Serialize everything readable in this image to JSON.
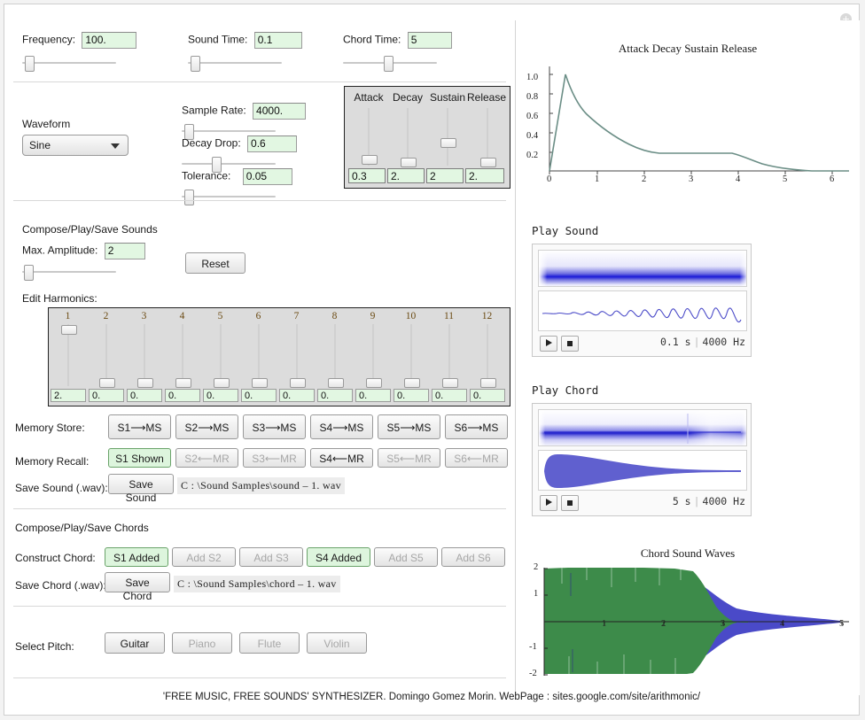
{
  "window": {
    "corner_icon": "gear-plus-icon"
  },
  "top_controls": [
    {
      "label": "Frequency:",
      "value": "100.",
      "slider_pct": 3
    },
    {
      "label": "Sound Time:",
      "value": "0.1",
      "slider_pct": 3
    },
    {
      "label": "Chord Time:",
      "value": "5",
      "slider_pct": 42
    }
  ],
  "waveform": {
    "label": "Waveform",
    "value": "Sine"
  },
  "mid_controls": [
    {
      "label": "Sample Rate:",
      "value": "4000.",
      "slider_pct": 3
    },
    {
      "label": "Decay Drop:",
      "value": "0.6",
      "slider_pct": 30
    },
    {
      "label": "Tolerance:",
      "value": "0.05",
      "slider_pct": 3
    }
  ],
  "adsr": {
    "columns": [
      {
        "name": "Attack",
        "value": "0.3",
        "thumb_pct": 82
      },
      {
        "name": "Decay",
        "value": "2.",
        "thumb_pct": 86
      },
      {
        "name": "Sustain",
        "value": "2",
        "thumb_pct": 52
      },
      {
        "name": "Release",
        "value": "2.",
        "thumb_pct": 86
      }
    ]
  },
  "sounds_section": {
    "title": "Compose/Play/Save Sounds",
    "max_amplitude_label": "Max. Amplitude:",
    "max_amplitude_value": "2",
    "max_amplitude_slider_pct": 3,
    "reset_label": "Reset",
    "edit_harmonics_label": "Edit Harmonics:",
    "harmonics": [
      {
        "n": "1",
        "value": "2.",
        "thumb_pct": 2
      },
      {
        "n": "2",
        "value": "0.",
        "thumb_pct": 92
      },
      {
        "n": "3",
        "value": "0.",
        "thumb_pct": 92
      },
      {
        "n": "4",
        "value": "0.",
        "thumb_pct": 92
      },
      {
        "n": "5",
        "value": "0.",
        "thumb_pct": 92
      },
      {
        "n": "6",
        "value": "0.",
        "thumb_pct": 92
      },
      {
        "n": "7",
        "value": "0.",
        "thumb_pct": 92
      },
      {
        "n": "8",
        "value": "0.",
        "thumb_pct": 92
      },
      {
        "n": "9",
        "value": "0.",
        "thumb_pct": 92
      },
      {
        "n": "10",
        "value": "0.",
        "thumb_pct": 92
      },
      {
        "n": "11",
        "value": "0.",
        "thumb_pct": 92
      },
      {
        "n": "12",
        "value": "0.",
        "thumb_pct": 92
      }
    ],
    "memory_store_label": "Memory Store:",
    "memory_store": [
      {
        "label": "S1⟶MS",
        "state": "normal"
      },
      {
        "label": "S2⟶MS",
        "state": "normal"
      },
      {
        "label": "S3⟶MS",
        "state": "normal"
      },
      {
        "label": "S4⟶MS",
        "state": "normal"
      },
      {
        "label": "S5⟶MS",
        "state": "normal"
      },
      {
        "label": "S6⟶MS",
        "state": "normal"
      }
    ],
    "memory_recall_label": "Memory Recall:",
    "memory_recall": [
      {
        "label": "S1 Shown",
        "state": "green"
      },
      {
        "label": "S2⟵MR",
        "state": "disabled"
      },
      {
        "label": "S3⟵MR",
        "state": "disabled"
      },
      {
        "label": "S4⟵MR",
        "state": "normal"
      },
      {
        "label": "S5⟵MR",
        "state": "disabled"
      },
      {
        "label": "S6⟵MR",
        "state": "disabled"
      }
    ],
    "save_sound_label": "Save Sound (.wav):",
    "save_sound_button": "Save Sound",
    "save_sound_path": "C : \\Sound Samples\\sound – 1. wav"
  },
  "chords_section": {
    "title": "Compose/Play/Save Chords",
    "construct_label": "Construct Chord:",
    "construct": [
      {
        "label": "S1 Added",
        "state": "green"
      },
      {
        "label": "Add S2",
        "state": "disabled"
      },
      {
        "label": "Add S3",
        "state": "disabled"
      },
      {
        "label": "S4 Added",
        "state": "green"
      },
      {
        "label": "Add S5",
        "state": "disabled"
      },
      {
        "label": "Add S6",
        "state": "disabled"
      }
    ],
    "save_chord_label": "Save Chord (.wav):",
    "save_chord_button": "Save Chord",
    "save_chord_path": "C : \\Sound Samples\\chord – 1. wav"
  },
  "pitch_section": {
    "label": "Select Pitch:",
    "buttons": [
      {
        "label": "Guitar",
        "state": "normal"
      },
      {
        "label": "Piano",
        "state": "disabled"
      },
      {
        "label": "Flute",
        "state": "disabled"
      },
      {
        "label": "Violin",
        "state": "disabled"
      }
    ]
  },
  "play_sound": {
    "title": "Play Sound",
    "duration": "0.1 s",
    "sample_rate": "4000 Hz",
    "play_icon": "play-icon",
    "stop_icon": "stop-icon"
  },
  "play_chord": {
    "title": "Play Chord",
    "duration": "5 s",
    "sample_rate": "4000 Hz",
    "play_icon": "play-icon",
    "stop_icon": "stop-icon"
  },
  "footer": "'FREE MUSIC, FREE SOUNDS' SYNTHESIZER. Domingo Gomez Morin. WebPage : sites.google.com/site/arithmonic/",
  "colors": {
    "field_green": "#e2f7e2",
    "button_green": "#ddf5dd",
    "adsr_curve": "#6b8e86",
    "wave_blue": "#4a4ac8",
    "wave_green": "#3d8b4a",
    "panel_gray": "#dcdcdc"
  },
  "chart_data": [
    {
      "type": "line",
      "title": "Attack Decay Sustain Release",
      "xlabel": "",
      "ylabel": "",
      "xlim": [
        0,
        6.4
      ],
      "ylim": [
        0,
        1.08
      ],
      "xticks": [
        0,
        1,
        2,
        3,
        4,
        5,
        6
      ],
      "yticks": [
        0.2,
        0.4,
        0.6,
        0.8,
        1.0
      ],
      "ytick_labels": [
        "0.2",
        "0.4",
        "0.6",
        "0.8",
        "1.0"
      ],
      "grid": false,
      "legend": "none",
      "color": "#6b8e86",
      "points": [
        [
          0.0,
          0.0
        ],
        [
          0.33,
          1.0
        ],
        [
          0.5,
          0.82
        ],
        [
          0.7,
          0.69
        ],
        [
          0.9,
          0.6
        ],
        [
          1.1,
          0.51
        ],
        [
          1.3,
          0.44
        ],
        [
          1.5,
          0.38
        ],
        [
          1.7,
          0.31
        ],
        [
          1.9,
          0.26
        ],
        [
          2.1,
          0.22
        ],
        [
          2.3,
          0.19
        ],
        [
          4.3,
          0.19
        ],
        [
          4.6,
          0.14
        ],
        [
          4.9,
          0.1
        ],
        [
          5.2,
          0.07
        ],
        [
          5.6,
          0.04
        ],
        [
          6.0,
          0.02
        ],
        [
          6.35,
          0.01
        ]
      ]
    },
    {
      "type": "area",
      "title": "Chord Sound Waves",
      "xlabel": "",
      "ylabel": "",
      "xlim": [
        0,
        5.15
      ],
      "ylim": [
        -2,
        2
      ],
      "xticks": [
        1,
        2,
        3,
        4,
        5
      ],
      "yticks": [
        -2,
        -1,
        0,
        1,
        2
      ],
      "ytick_labels": [
        "-2",
        "-1",
        "",
        "1",
        "2"
      ],
      "grid": false,
      "legend": "none",
      "series": [
        {
          "name": "chord-envelope-blue",
          "color": "#4a4ac8",
          "envelope": [
            [
              0,
              1.95
            ],
            [
              0.5,
              1.95
            ],
            [
              1.0,
              1.9
            ],
            [
              1.6,
              1.85
            ],
            [
              2.2,
              1.8
            ],
            [
              2.6,
              1.2
            ],
            [
              3.0,
              0.55
            ],
            [
              3.3,
              0.42
            ],
            [
              3.7,
              0.36
            ],
            [
              4.0,
              0.34
            ],
            [
              4.3,
              0.3
            ],
            [
              4.7,
              0.2
            ],
            [
              5.0,
              0.06
            ]
          ]
        },
        {
          "name": "sound-envelope-green",
          "color": "#3d8b4a",
          "envelope": [
            [
              0,
              1.98
            ],
            [
              0.4,
              2.0
            ],
            [
              0.9,
              2.0
            ],
            [
              1.4,
              2.0
            ],
            [
              1.9,
              2.0
            ],
            [
              2.2,
              1.95
            ],
            [
              2.45,
              1.6
            ],
            [
              2.7,
              1.1
            ],
            [
              2.95,
              0.72
            ],
            [
              3.15,
              0.45
            ],
            [
              3.4,
              0.28
            ],
            [
              3.7,
              0.16
            ],
            [
              4.0,
              0.06
            ],
            [
              4.15,
              0.0
            ]
          ]
        }
      ]
    }
  ]
}
